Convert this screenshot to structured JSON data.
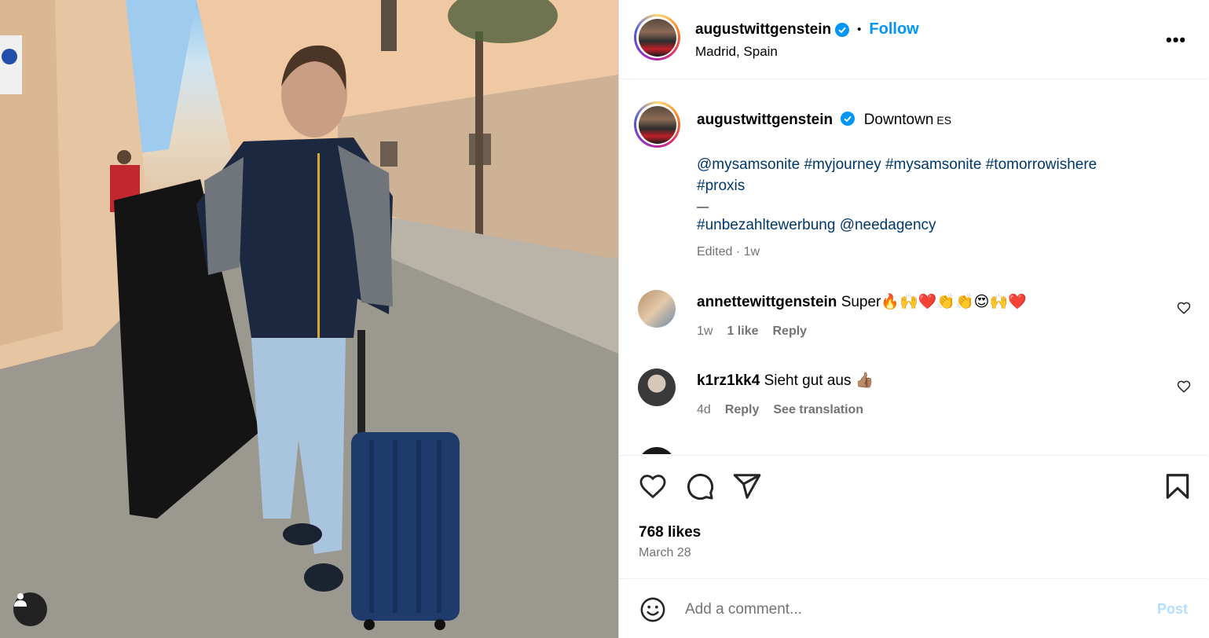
{
  "post": {
    "username": "augustwittgenstein",
    "separator": "•",
    "follow_label": "Follow",
    "location": "Madrid, Spain",
    "more_label": "•••",
    "caption_title": "Downtown",
    "caption_lang": "ES",
    "hashtags_line1": "@mysamsonite #myjourney #mysamsonite #tomorrowishere",
    "hashtags_line2": "#proxis",
    "separator_line": "—",
    "hashtags_line3": "#unbezahltewerbung @needagency",
    "edited": "Edited · 1w"
  },
  "comments": [
    {
      "username": "annettewittgenstein",
      "text": "Super🔥🙌❤️👏👏😍🙌❤️",
      "age": "1w",
      "likes": "1 like",
      "reply": "Reply"
    },
    {
      "username": "k1rz1kk4",
      "text": "Sieht gut aus 👍🏽",
      "age": "4d",
      "reply": "Reply",
      "translate": "See translation"
    }
  ],
  "stats": {
    "likes": "768 likes",
    "date": "March 28"
  },
  "composer": {
    "placeholder": "Add a comment...",
    "post_label": "Post"
  },
  "colors": {
    "accent": "#0095f6",
    "hashtag": "#00376b",
    "muted": "#737373",
    "post_disabled": "#b2dffc"
  }
}
